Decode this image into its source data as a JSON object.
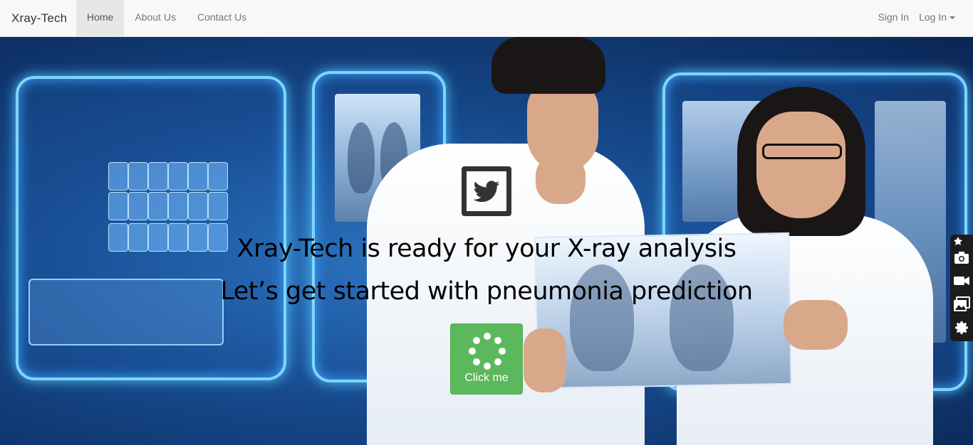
{
  "navbar": {
    "brand": "Xray-Tech",
    "links": [
      {
        "label": "Home",
        "active": true
      },
      {
        "label": "About Us",
        "active": false
      },
      {
        "label": "Contact Us",
        "active": false
      }
    ],
    "sign_in": "Sign In",
    "log_in": "Log In"
  },
  "hero": {
    "logo_icon": "twitter-bird-icon",
    "headline_1": "Xray-Tech is ready for your X-ray analysis",
    "headline_2": "Let’s get started with pneumonia prediction",
    "cta_label": "Click me",
    "cta_icon": "spinner-icon",
    "cta_color": "#5cb85c"
  },
  "side_toolbar": {
    "tools": [
      "pin-icon",
      "camera-icon",
      "video-icon",
      "image-icon",
      "gear-icon"
    ]
  }
}
